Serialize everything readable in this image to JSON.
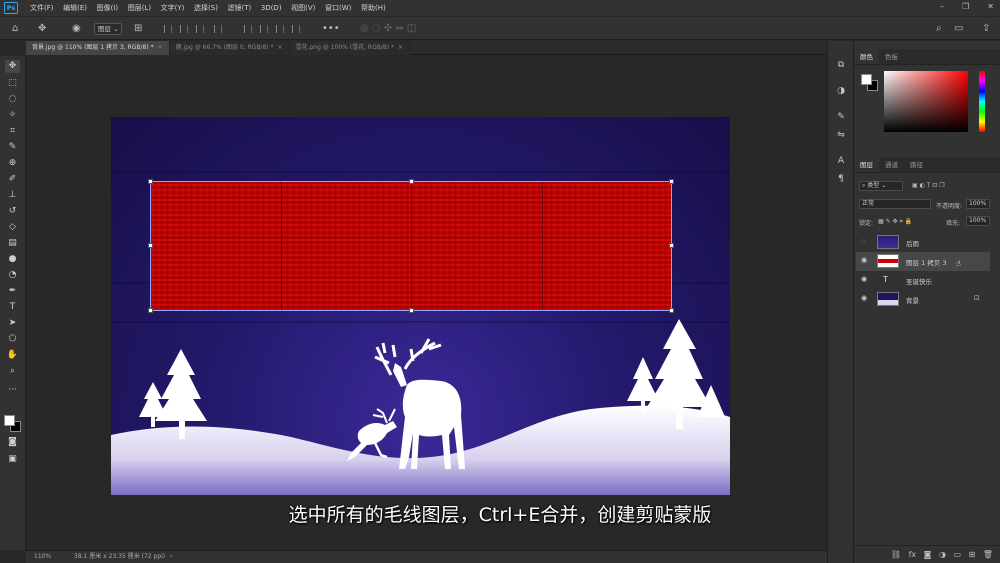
{
  "app": {
    "logo": "Ps"
  },
  "menu": [
    "文件(F)",
    "编辑(E)",
    "图像(I)",
    "图层(L)",
    "文字(Y)",
    "选择(S)",
    "滤镜(T)",
    "3D(D)",
    "视图(V)",
    "窗口(W)",
    "帮助(H)"
  ],
  "options_bar": {
    "layer_select": "图层"
  },
  "tabs": [
    {
      "label": "背景.jpg @ 110% (图层 1 拷贝 3, RGB/8) *",
      "active": true
    },
    {
      "label": "鹿.jpg @ 66.7% (图层 0, RGB/8) *",
      "active": false
    },
    {
      "label": "雪花.png @ 100% (雪花, RGB/8) *",
      "active": false
    }
  ],
  "color_panel": {
    "tabs": [
      "颜色",
      "色板"
    ],
    "foreground": "#ffffff",
    "background": "#000000"
  },
  "layers_panel": {
    "tabs": [
      "图层",
      "通道",
      "路径"
    ],
    "filter_kind": "类型",
    "blend_mode": "正常",
    "opacity_label": "不透明度:",
    "opacity_value": "100%",
    "lock_label": "锁定:",
    "fill_label": "填充:",
    "fill_value": "100%",
    "layers": [
      {
        "name": "后雨",
        "visible": false,
        "selected": false,
        "type": "image"
      },
      {
        "name": "图层 1 拷贝 3",
        "visible": true,
        "selected": true,
        "type": "image"
      },
      {
        "name": "圣诞快乐",
        "visible": true,
        "selected": false,
        "type": "text"
      },
      {
        "name": "背景",
        "visible": true,
        "selected": false,
        "type": "image",
        "locked": true
      }
    ]
  },
  "status": {
    "zoom": "110%",
    "doc_size": "38.1 厘米 x 23.35 厘米 (72 ppi)"
  },
  "subtitle": "选中所有的毛线图层，Ctrl+E合并，创建剪贴蒙版"
}
